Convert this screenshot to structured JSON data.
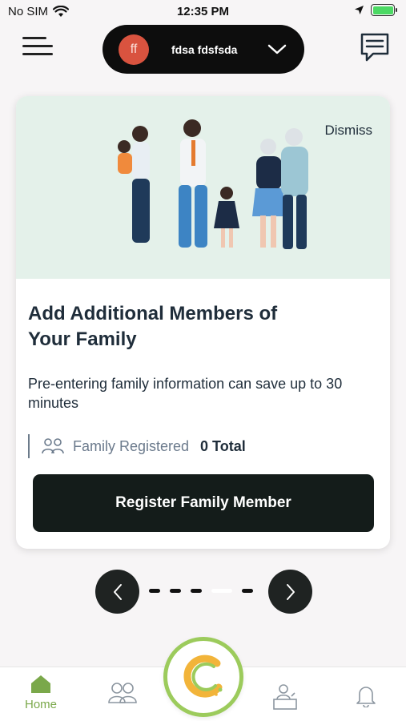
{
  "status_bar": {
    "carrier": "No SIM",
    "time": "12:35 PM"
  },
  "header": {
    "avatar_initials": "ff",
    "profile_name": "fdsa fdsfsda"
  },
  "card": {
    "dismiss_label": "Dismiss",
    "title": "Add Additional Members of Your Family",
    "description": "Pre-entering family information can save up to 30 minutes",
    "family_label": "Family Registered",
    "family_total": "0 Total",
    "button_label": "Register Family Member"
  },
  "pager": {
    "total_pages": 5,
    "active_page": 4
  },
  "tab_bar": {
    "home_label": "Home"
  },
  "colors": {
    "accent_green": "#9ccb5c",
    "home_green": "#7aa84a",
    "avatar_red": "#d9533f",
    "hero_bg": "#e4f1ea",
    "button_dark": "#141c1a"
  }
}
